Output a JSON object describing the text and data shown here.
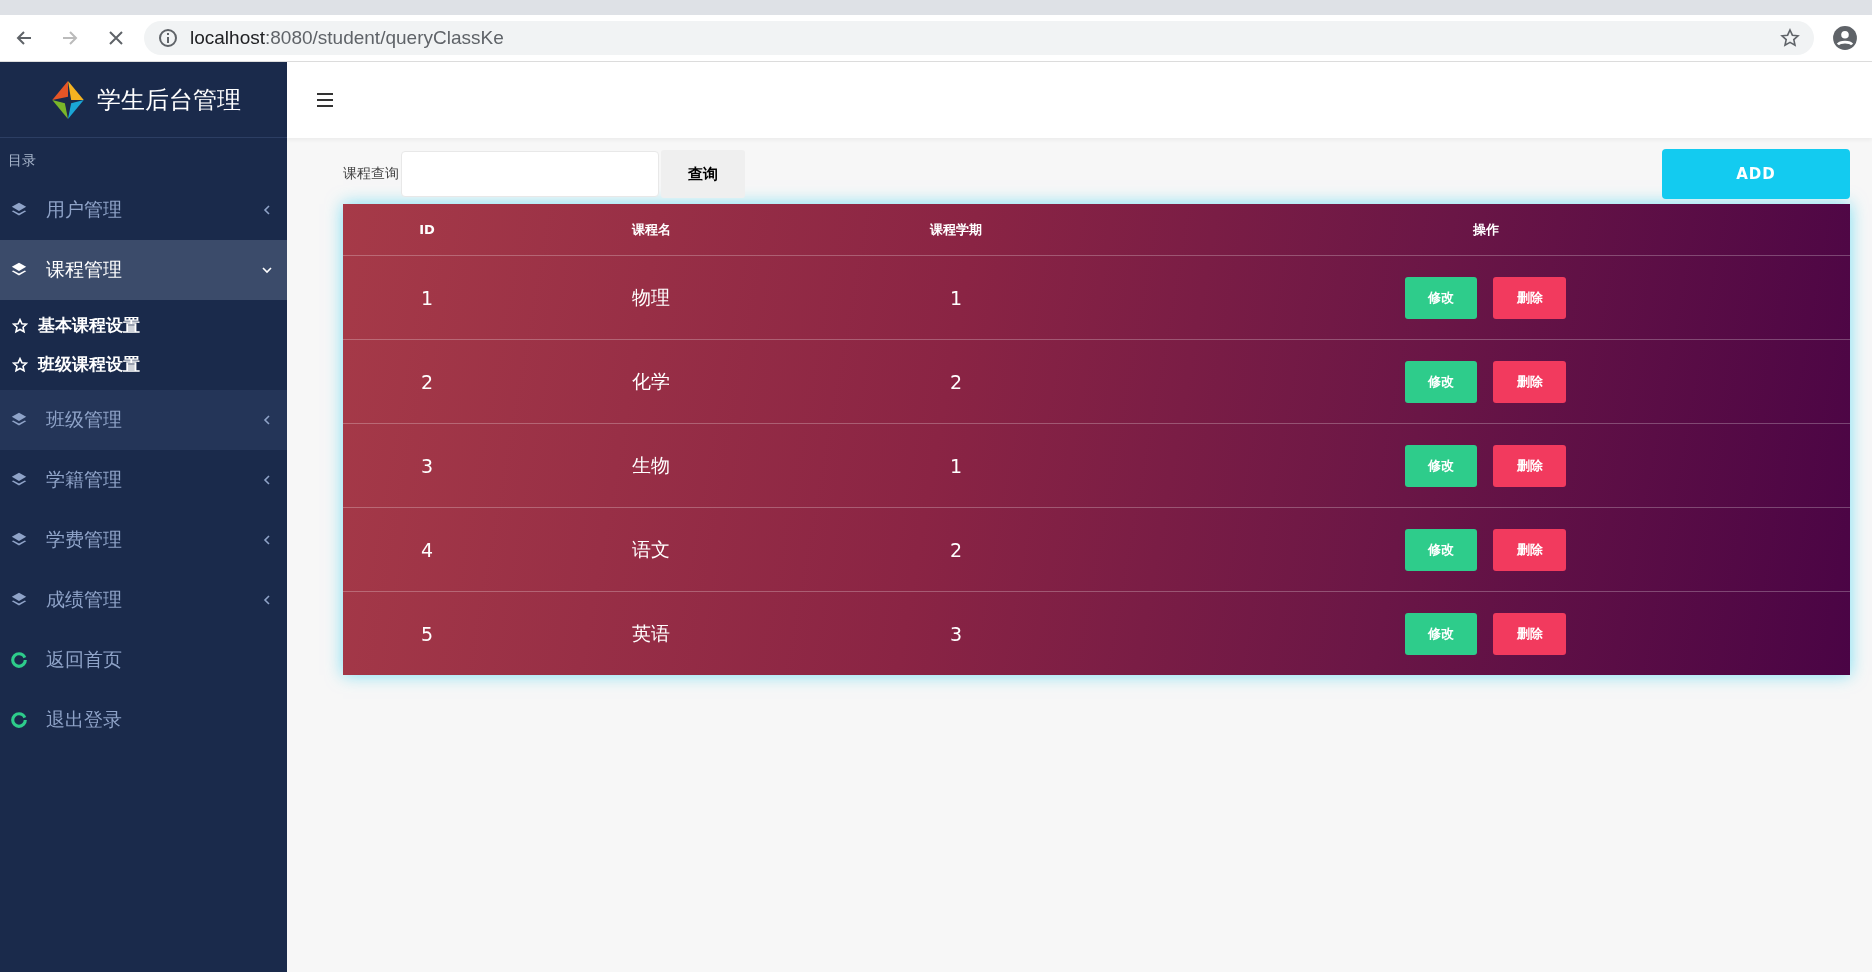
{
  "browser": {
    "url_host": "localhost",
    "url_rest": ":8080/student/queryClassKe"
  },
  "sidebar": {
    "title": "学生后台管理",
    "section": "目录",
    "items": [
      {
        "label": "用户管理",
        "kind": "group",
        "expanded": false,
        "hovered": false
      },
      {
        "label": "课程管理",
        "kind": "group",
        "expanded": true,
        "hovered": false,
        "children": [
          {
            "label": "基本课程设置"
          },
          {
            "label": "班级课程设置"
          }
        ]
      },
      {
        "label": "班级管理",
        "kind": "group",
        "expanded": false,
        "hovered": true
      },
      {
        "label": "学籍管理",
        "kind": "group",
        "expanded": false,
        "hovered": false
      },
      {
        "label": "学费管理",
        "kind": "group",
        "expanded": false,
        "hovered": false
      },
      {
        "label": "成绩管理",
        "kind": "group",
        "expanded": false,
        "hovered": false
      },
      {
        "label": "返回首页",
        "kind": "link"
      },
      {
        "label": "退出登录",
        "kind": "link"
      }
    ]
  },
  "search": {
    "label": "课程查询",
    "button": "查询"
  },
  "add_button": "ADD",
  "table": {
    "columns": [
      "ID",
      "课程名",
      "课程学期",
      "操作"
    ],
    "rows": [
      {
        "id": "1",
        "name": "物理",
        "term": "1",
        "edit": "修改",
        "delete": "删除"
      },
      {
        "id": "2",
        "name": "化学",
        "term": "2",
        "edit": "修改",
        "delete": "删除"
      },
      {
        "id": "3",
        "name": "生物",
        "term": "1",
        "edit": "修改",
        "delete": "删除"
      },
      {
        "id": "4",
        "name": "语文",
        "term": "2",
        "edit": "修改",
        "delete": "删除"
      },
      {
        "id": "5",
        "name": "英语",
        "term": "3",
        "edit": "修改",
        "delete": "删除"
      }
    ]
  }
}
